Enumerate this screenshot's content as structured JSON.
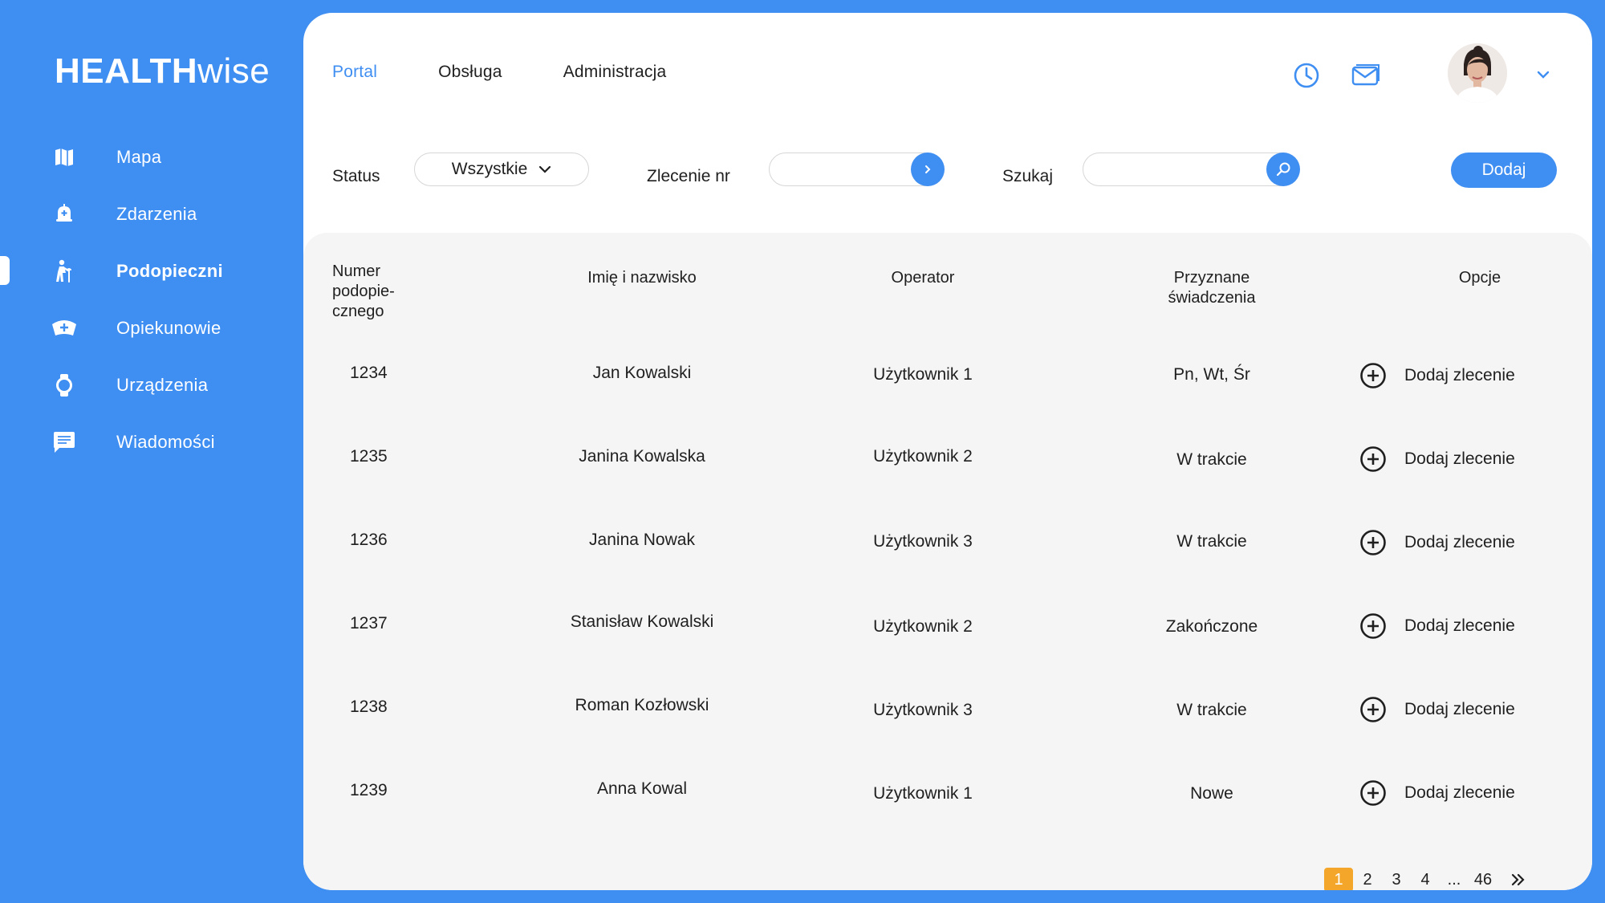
{
  "brand": {
    "bold": "HEALTH",
    "light": "wise"
  },
  "sidebar": {
    "items": [
      {
        "label": "Mapa",
        "icon": "map-icon",
        "active": false
      },
      {
        "label": "Zdarzenia",
        "icon": "alarm-bell-icon",
        "active": false
      },
      {
        "label": "Podopieczni",
        "icon": "elderly-person-icon",
        "active": true
      },
      {
        "label": "Opiekunowie",
        "icon": "nurse-cap-icon",
        "active": false
      },
      {
        "label": "Urządzenia",
        "icon": "smartwatch-icon",
        "active": false
      },
      {
        "label": "Wiadomości",
        "icon": "chat-message-icon",
        "active": false
      }
    ]
  },
  "header": {
    "tabs": [
      {
        "label": "Portal",
        "active": true
      },
      {
        "label": "Obsługa",
        "active": false
      },
      {
        "label": "Administracja",
        "active": false
      }
    ],
    "icons": [
      "clock-icon",
      "mail-icon",
      "avatar",
      "chevron-down-icon"
    ]
  },
  "filters": {
    "status_label": "Status",
    "status_value": "Wszystkie",
    "order_label": "Zlecenie nr",
    "order_value": "",
    "search_label": "Szukaj",
    "search_value": "",
    "add_label": "Dodaj"
  },
  "table": {
    "headers": {
      "number_l1": "Numer",
      "number_l2": "podopie-",
      "number_l3": "cznego",
      "name": "Imię i nazwisko",
      "operator": "Operator",
      "benefits_l1": "Przyznane",
      "benefits_l2": "świadczenia",
      "options": "Opcje"
    },
    "rows": [
      {
        "number": "1234",
        "name": "Jan Kowalski",
        "operator": "Użytkownik 1",
        "benefits": "Pn, Wt, Śr",
        "option": "Dodaj zlecenie"
      },
      {
        "number": "1235",
        "name": "Janina Kowalska",
        "operator": "Użytkownik 2",
        "benefits": "W trakcie",
        "option": "Dodaj zlecenie"
      },
      {
        "number": "1236",
        "name": "Janina Nowak",
        "operator": "Użytkownik 3",
        "benefits": "W trakcie",
        "option": "Dodaj zlecenie"
      },
      {
        "number": "1237",
        "name": "Stanisław Kowalski",
        "operator": "Użytkownik 2",
        "benefits": "Zakończone",
        "option": "Dodaj zlecenie"
      },
      {
        "number": "1238",
        "name": "Roman Kozłowski",
        "operator": "Użytkownik 3",
        "benefits": "W trakcie",
        "option": "Dodaj zlecenie"
      },
      {
        "number": "1239",
        "name": "Anna Kowal",
        "operator": "Użytkownik 1",
        "benefits": "Nowe",
        "option": "Dodaj zlecenie"
      }
    ]
  },
  "pagination": {
    "pages": [
      "1",
      "2",
      "3",
      "4",
      "...",
      "46"
    ],
    "current": "1",
    "next_icon": "double-chevron-right-icon"
  },
  "colors": {
    "primary": "#3F8EF2",
    "accent": "#F4A62A",
    "panel": "#FFFFFF",
    "table_bg": "#F5F5F5",
    "text": "#1F1F1F"
  }
}
